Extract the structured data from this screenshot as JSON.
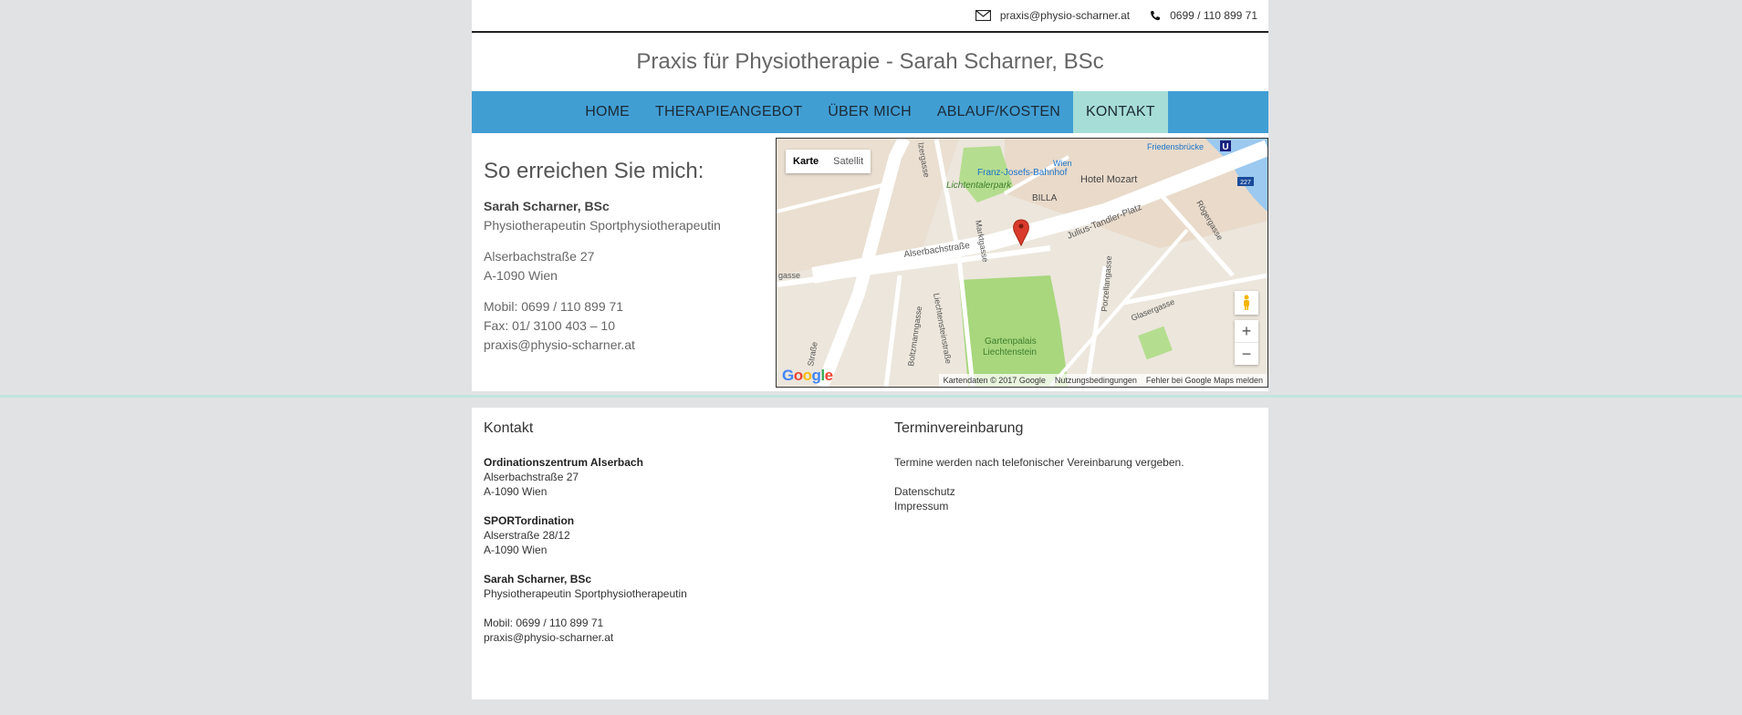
{
  "topbar": {
    "email_icon": "envelope-icon",
    "email": "praxis@physio-scharner.at",
    "phone_icon": "phone-icon",
    "phone": "0699 / 110 899 71"
  },
  "header": {
    "title": "Praxis für Physiotherapie - Sarah Scharner, BSc"
  },
  "nav": {
    "items": [
      {
        "label": "HOME"
      },
      {
        "label": "THERAPIEANGEBOT"
      },
      {
        "label": "ÜBER MICH"
      },
      {
        "label": "ABLAUF/KOSTEN"
      },
      {
        "label": "KONTAKT"
      }
    ],
    "active": "KONTAKT"
  },
  "reach": {
    "heading": "So erreichen Sie mich:",
    "name": "Sarah Scharner, BSc",
    "role": "Physiotherapeutin Sportphysiotherapeutin",
    "street": "Alserbachstraße 27",
    "city": "A-1090 Wien",
    "mobile": "Mobil: 0699 / 110 899 71",
    "fax": "Fax: 01/ 3100 403 – 10",
    "email": "praxis@physio-scharner.at"
  },
  "map": {
    "tab_map": "Karte",
    "tab_satellite": "Satellit",
    "zoom_in": "+",
    "zoom_out": "−",
    "logo": "Google",
    "attribution": "Kartendaten © 2017 Google",
    "terms": "Nutzungsbedingungen",
    "report": "Fehler bei Google Maps melden",
    "labels": {
      "alserbachstrasse": "Alserbachstraße",
      "julius": "Julius-Tandler-Platz",
      "lichtentalerpark": "Lichtentalerpark",
      "fjb": "Franz-Josefs-Bahnhof",
      "wien": "Wien",
      "hotel": "Hotel Mozart",
      "billa": "BILLA",
      "marktgasse": "Marktgasse",
      "roeger": "Rögergasse",
      "porzellan": "Porzellangasse",
      "glaser": "Glasergasse",
      "gartenpalais": "Gartenpalais",
      "liechtenstein": "Liechtenstein",
      "boltzmann": "Boltzmanngasse",
      "liechtensteinstr": "Liechtensteinstraße",
      "friedensbruecke": "Friedensbrücke",
      "gasse": "gasse",
      "strasse": "Straße",
      "lzergasse": "lzergasse",
      "u": "U",
      "n227": "227"
    }
  },
  "footer": {
    "kontakt": {
      "heading": "Kontakt",
      "org1_name": "Ordinationszentrum Alserbach",
      "org1_street": "Alserbachstraße 27",
      "org1_city": "A-1090 Wien",
      "org2_name": "SPORTordination",
      "org2_street": "Alserstraße 28/12",
      "org2_city": "A-1090 Wien",
      "person_name": "Sarah Scharner, BSc",
      "person_role": "Physiotherapeutin Sportphysiotherapeutin",
      "mobile": "Mobil: 0699 / 110 899 71",
      "email": "praxis@physio-scharner.at"
    },
    "termin": {
      "heading": "Terminvereinbarung",
      "text": "Termine werden nach telefonischer Vereinbarung vergeben.",
      "datenschutz": "Datenschutz",
      "impressum": "Impressum"
    }
  }
}
